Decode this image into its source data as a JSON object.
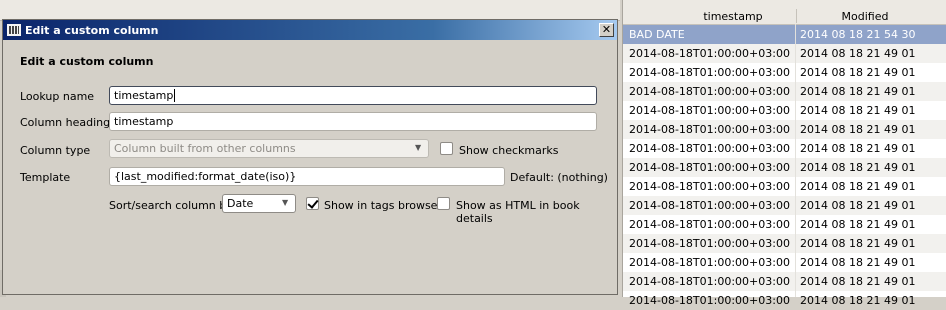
{
  "dialog": {
    "title": "Edit a custom column",
    "heading": "Edit a custom column",
    "close_glyph": "✕",
    "lookup_label": "Lookup name",
    "lookup_value": "timestamp",
    "heading_label": "Column heading",
    "heading_value": "timestamp",
    "type_label": "Column type",
    "type_value": "Column built from other columns",
    "show_checkmarks_label": "Show checkmarks",
    "template_label": "Template",
    "template_value": "{last_modified:format_date(iso)}",
    "default_text": "Default: (nothing)",
    "sort_label": "Sort/search column by",
    "sort_value": "Date",
    "show_tags_label": "Show in tags browser",
    "show_tags_checked": true,
    "show_html_label": "Show as HTML in book details",
    "show_html_checked": false
  },
  "table": {
    "columns": [
      "timestamp",
      "Modified"
    ],
    "rows": [
      {
        "timestamp": "BAD DATE",
        "modified": "2014 08 18 21 54 30",
        "selected": true
      },
      {
        "timestamp": "2014-08-18T01:00:00+03:00",
        "modified": "2014 08 18 21 49 01"
      },
      {
        "timestamp": "2014-08-18T01:00:00+03:00",
        "modified": "2014 08 18 21 49 01"
      },
      {
        "timestamp": "2014-08-18T01:00:00+03:00",
        "modified": "2014 08 18 21 49 01"
      },
      {
        "timestamp": "2014-08-18T01:00:00+03:00",
        "modified": "2014 08 18 21 49 01"
      },
      {
        "timestamp": "2014-08-18T01:00:00+03:00",
        "modified": "2014 08 18 21 49 01"
      },
      {
        "timestamp": "2014-08-18T01:00:00+03:00",
        "modified": "2014 08 18 21 49 01"
      },
      {
        "timestamp": "2014-08-18T01:00:00+03:00",
        "modified": "2014 08 18 21 49 01"
      },
      {
        "timestamp": "2014-08-18T01:00:00+03:00",
        "modified": "2014 08 18 21 49 01"
      },
      {
        "timestamp": "2014-08-18T01:00:00+03:00",
        "modified": "2014 08 18 21 49 01"
      },
      {
        "timestamp": "2014-08-18T01:00:00+03:00",
        "modified": "2014 08 18 21 49 01"
      },
      {
        "timestamp": "2014-08-18T01:00:00+03:00",
        "modified": "2014 08 18 21 49 01"
      },
      {
        "timestamp": "2014-08-18T01:00:00+03:00",
        "modified": "2014 08 18 21 49 01"
      },
      {
        "timestamp": "2014-08-18T01:00:00+03:00",
        "modified": "2014 08 18 21 49 01"
      },
      {
        "timestamp": "2014-08-18T01:00:00+03:00",
        "modified": "2014 08 18 21 49 01"
      }
    ]
  },
  "colors": {
    "titlebar_start": "#0a246a",
    "selected_row": "#8fa3c9",
    "dialog_bg": "#d4d0c8"
  }
}
